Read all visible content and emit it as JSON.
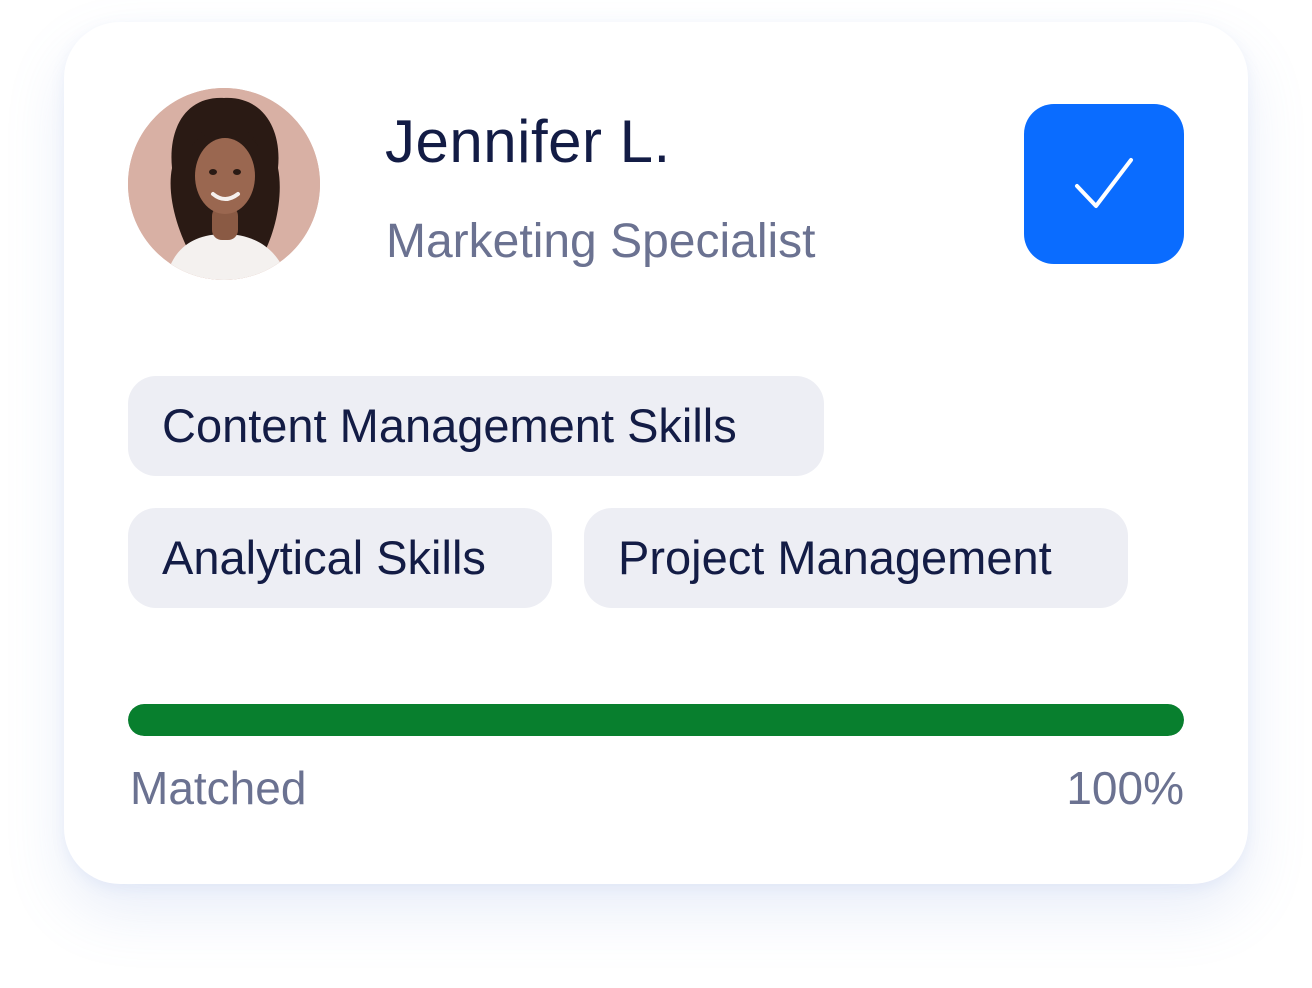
{
  "profile": {
    "name": "Jennifer L.",
    "role": "Marketing Specialist",
    "avatar_icon": "person-portrait"
  },
  "select_button": {
    "icon": "check-icon",
    "selected": true,
    "color": "#0a6cff"
  },
  "skills": [
    {
      "label": "Content Management Skills"
    },
    {
      "label": "Analytical Skills"
    },
    {
      "label": "Project Management"
    }
  ],
  "match": {
    "label": "Matched",
    "value_text": "100%",
    "percent": 100,
    "bar_color": "#087f2e"
  }
}
